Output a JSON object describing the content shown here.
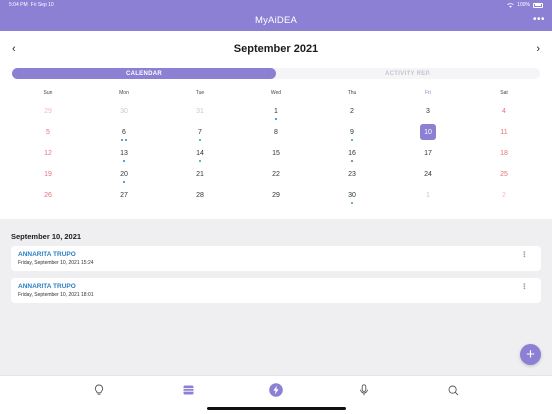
{
  "status_bar": {
    "time": "5:04 PM",
    "date": "Fri Sep 10",
    "battery": "100%"
  },
  "header": {
    "title": "MyAiDEA"
  },
  "calendar": {
    "month_title": "September 2021",
    "tabs": [
      {
        "label": "CALENDAR"
      },
      {
        "label": "ACTIVITY REP."
      }
    ],
    "weekdays": [
      "Sun",
      "Mon",
      "Tue",
      "Wed",
      "Thu",
      "Fri",
      "Sat"
    ],
    "weeks": [
      [
        {
          "d": "29",
          "o": true
        },
        {
          "d": "30",
          "o": true
        },
        {
          "d": "31",
          "o": true
        },
        {
          "d": "1",
          "dots": [
            "#2b7fc1"
          ]
        },
        {
          "d": "2"
        },
        {
          "d": "3"
        },
        {
          "d": "4"
        }
      ],
      [
        {
          "d": "5"
        },
        {
          "d": "6",
          "dots": [
            "#2b7fc1",
            "#2b7fc1"
          ]
        },
        {
          "d": "7",
          "dots": [
            "#18a999"
          ]
        },
        {
          "d": "8"
        },
        {
          "d": "9",
          "dots": [
            "#18a999"
          ]
        },
        {
          "d": "10",
          "selected": true
        },
        {
          "d": "11"
        }
      ],
      [
        {
          "d": "12"
        },
        {
          "d": "13",
          "dots": [
            "#2b7fc1"
          ]
        },
        {
          "d": "14",
          "dots": [
            "#18a999"
          ]
        },
        {
          "d": "15"
        },
        {
          "d": "16",
          "dots": [
            "#2b7fc1"
          ]
        },
        {
          "d": "17"
        },
        {
          "d": "18"
        }
      ],
      [
        {
          "d": "19"
        },
        {
          "d": "20",
          "dots": [
            "#2b7fc1"
          ]
        },
        {
          "d": "21"
        },
        {
          "d": "22"
        },
        {
          "d": "23"
        },
        {
          "d": "24"
        },
        {
          "d": "25"
        }
      ],
      [
        {
          "d": "26"
        },
        {
          "d": "27"
        },
        {
          "d": "28"
        },
        {
          "d": "29"
        },
        {
          "d": "30",
          "dots": [
            "#18a999"
          ]
        },
        {
          "d": "1",
          "o": true
        },
        {
          "d": "2",
          "o": true
        }
      ]
    ]
  },
  "agenda": {
    "date_heading": "September 10, 2021",
    "appointments": [
      {
        "name": "ANNARITA TRUPO",
        "time": "Friday, September 10, 2021 15:24"
      },
      {
        "name": "ANNARITA TRUPO",
        "time": "Friday, September 10, 2021 18:01"
      }
    ]
  },
  "colors": {
    "accent": "#8b80d4",
    "weekend": "#e8707c",
    "link": "#2b7fc1",
    "teal_dot": "#18a999"
  },
  "tab_bar": {
    "items": [
      {
        "icon": "lightbulb-icon"
      },
      {
        "icon": "calendar-icon"
      },
      {
        "icon": "lightning-icon"
      },
      {
        "icon": "microphone-icon"
      },
      {
        "icon": "search-icon"
      }
    ]
  }
}
